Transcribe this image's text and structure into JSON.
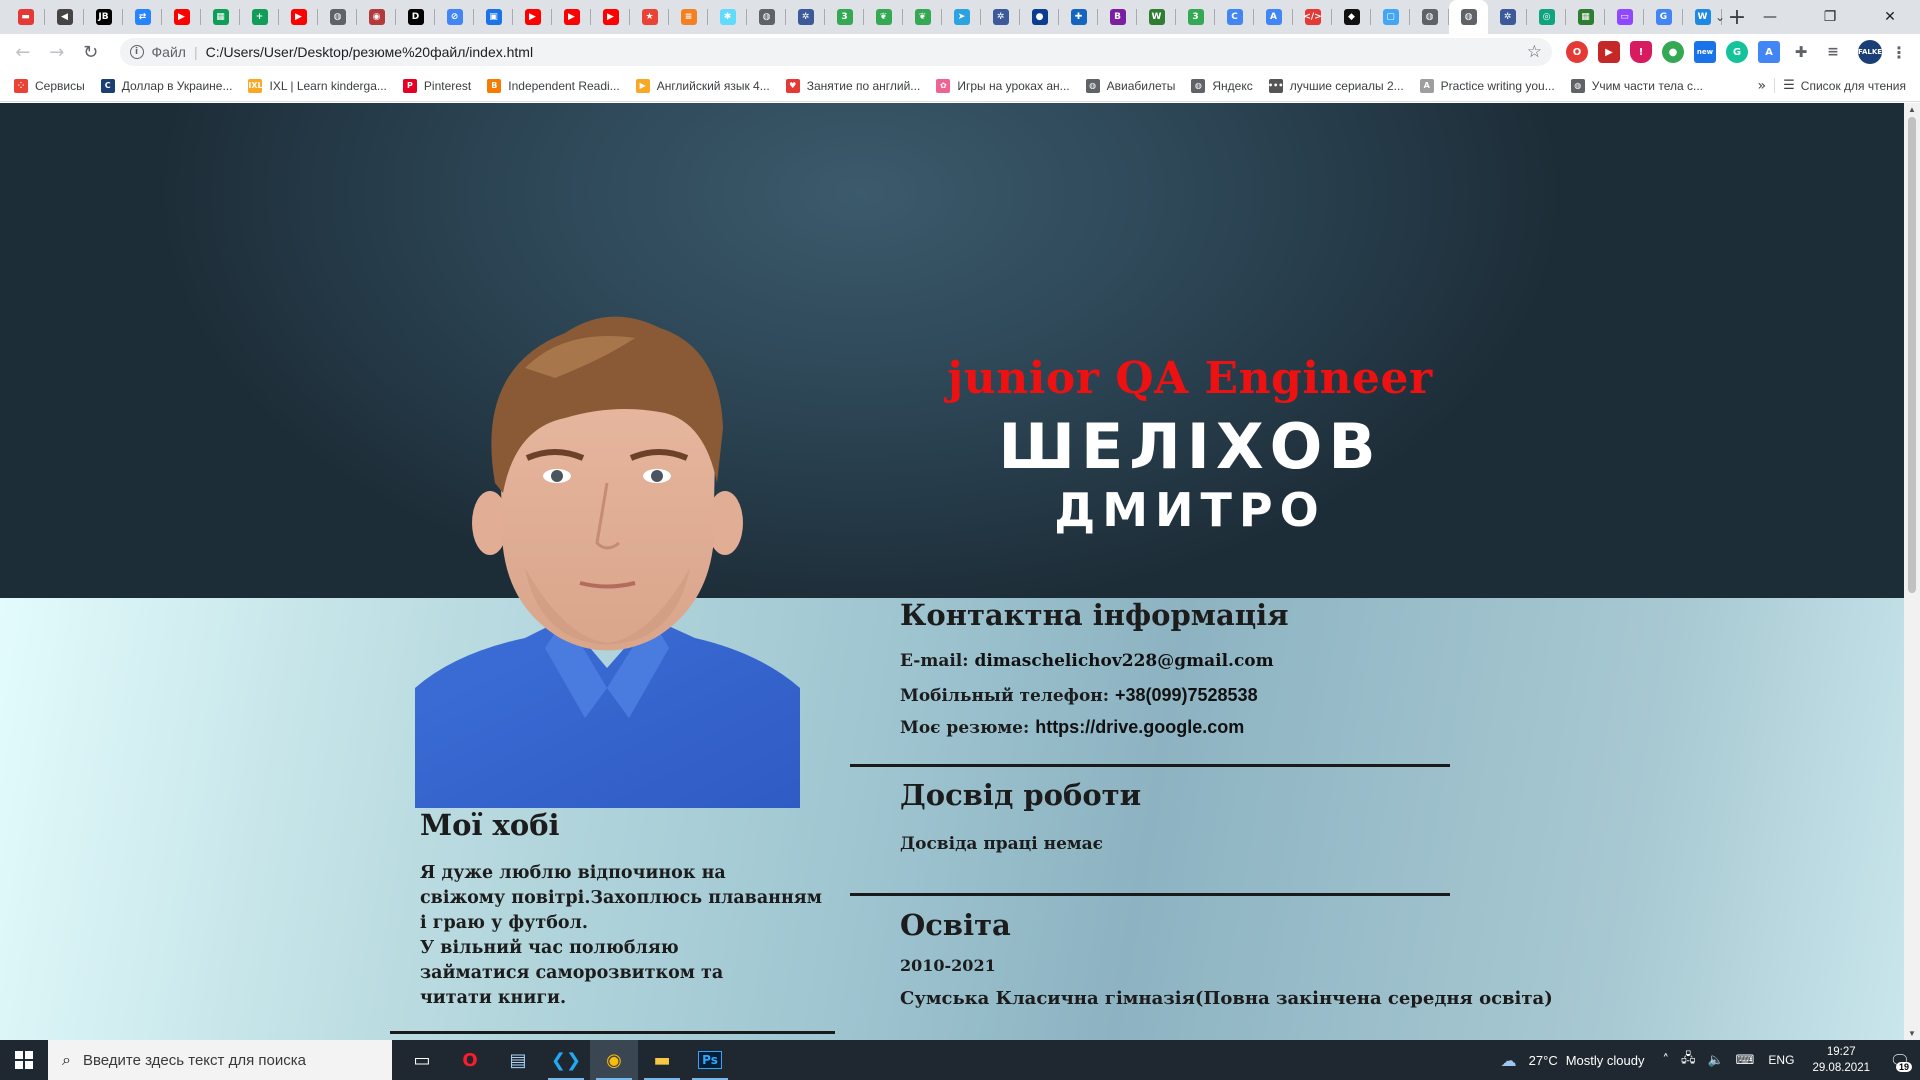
{
  "browser": {
    "tabs": [
      {
        "icon": "dou-icon",
        "color": "#e53935",
        "glyph": "▬"
      },
      {
        "icon": "audio-icon",
        "color": "#444444",
        "glyph": "◀"
      },
      {
        "icon": "jb-icon",
        "color": "#000000",
        "glyph": "JB"
      },
      {
        "icon": "jira-icon",
        "color": "#2684ff",
        "glyph": "⇄"
      },
      {
        "icon": "youtube-icon",
        "color": "#ff0000",
        "glyph": "▶"
      },
      {
        "icon": "sheets-icon",
        "color": "#0f9d58",
        "glyph": "▦"
      },
      {
        "icon": "sheets-plus-icon",
        "color": "#0f9d58",
        "glyph": "+"
      },
      {
        "icon": "youtube-icon",
        "color": "#ff0000",
        "glyph": "▶"
      },
      {
        "icon": "globe-icon",
        "color": "#5f6368",
        "glyph": "◍"
      },
      {
        "icon": "avatar-icon",
        "color": "#b23a3a",
        "glyph": "◉"
      },
      {
        "icon": "dou-text-icon",
        "color": "#000000",
        "glyph": "D"
      },
      {
        "icon": "compass-icon",
        "color": "#4285f4",
        "glyph": "⊘"
      },
      {
        "icon": "inbox-icon",
        "color": "#1a73e8",
        "glyph": "▣"
      },
      {
        "icon": "youtube-icon",
        "color": "#ff0000",
        "glyph": "▶"
      },
      {
        "icon": "youtube-icon",
        "color": "#ff0000",
        "glyph": "▶"
      },
      {
        "icon": "youtube-icon",
        "color": "#ff0000",
        "glyph": "▶"
      },
      {
        "icon": "star-icon",
        "color": "#ea4335",
        "glyph": "★"
      },
      {
        "icon": "stack-icon",
        "color": "#f48024",
        "glyph": "≡"
      },
      {
        "icon": "react-icon",
        "color": "#61dafb",
        "glyph": "✱"
      },
      {
        "icon": "globe-icon",
        "color": "#5f6368",
        "glyph": "◍"
      },
      {
        "icon": "gear-icon",
        "color": "#3c5a99",
        "glyph": "✲"
      },
      {
        "icon": "three-icon",
        "color": "#34a853",
        "glyph": "3"
      },
      {
        "icon": "leaf-icon",
        "color": "#34a853",
        "glyph": "❦"
      },
      {
        "icon": "leaf-icon",
        "color": "#34a853",
        "glyph": "❦"
      },
      {
        "icon": "telegram-icon",
        "color": "#2aa3e0",
        "glyph": "➤"
      },
      {
        "icon": "gear-icon",
        "color": "#3c5a99",
        "glyph": "✲"
      },
      {
        "icon": "circle-icon",
        "color": "#0b3d91",
        "glyph": "●"
      },
      {
        "icon": "puzzle-icon",
        "color": "#1565c0",
        "glyph": "✚"
      },
      {
        "icon": "bold-icon",
        "color": "#7b1fa2",
        "glyph": "B"
      },
      {
        "icon": "w-icon",
        "color": "#2e7d32",
        "glyph": "W"
      },
      {
        "icon": "three-icon",
        "color": "#34a853",
        "glyph": "3"
      },
      {
        "icon": "c-icon",
        "color": "#4285f4",
        "glyph": "C"
      },
      {
        "icon": "translate-icon",
        "color": "#4285f4",
        "glyph": "A"
      },
      {
        "icon": "code-icon",
        "color": "#e53935",
        "glyph": "</>"
      },
      {
        "icon": "diamond-icon",
        "color": "#111111",
        "glyph": "◆"
      },
      {
        "icon": "screenshot-icon",
        "color": "#42a5f5",
        "glyph": "▢"
      },
      {
        "icon": "globe-icon",
        "color": "#5f6368",
        "glyph": "◍"
      },
      {
        "icon": "globe-icon",
        "color": "#5f6368",
        "glyph": "◍"
      },
      {
        "icon": "gear-icon",
        "color": "#3c5a99",
        "glyph": "✲"
      },
      {
        "icon": "chatgpt-icon",
        "color": "#10a37f",
        "glyph": "◎"
      },
      {
        "icon": "grid-icon",
        "color": "#2e7d32",
        "glyph": "▦"
      },
      {
        "icon": "twitch-icon",
        "color": "#9146ff",
        "glyph": "▭"
      },
      {
        "icon": "google-icon",
        "color": "#4285f4",
        "glyph": "G"
      },
      {
        "icon": "w-icon",
        "color": "#1e88e5",
        "glyph": "W"
      }
    ],
    "active_tab_index": 37,
    "address": {
      "scheme_label": "Файл",
      "url": "C:/Users/User/Desktop/резюме%20файл/index.html"
    },
    "bookmarks": [
      {
        "label": "Сервисы",
        "icon": "apps-icon",
        "color": "#ea4335",
        "glyph": "⁘"
      },
      {
        "label": "Доллар в Украине...",
        "icon": "minfin-icon",
        "color": "#1a3e75",
        "glyph": "C"
      },
      {
        "label": "IXL | Learn kinderga...",
        "icon": "ixl-icon",
        "color": "#f9a825",
        "glyph": "IXL"
      },
      {
        "label": "Pinterest",
        "icon": "pinterest-icon",
        "color": "#e60023",
        "glyph": "P"
      },
      {
        "label": "Independent Readi...",
        "icon": "blogger-icon",
        "color": "#f57c00",
        "glyph": "B"
      },
      {
        "label": "Английский язык 4...",
        "icon": "play-icon",
        "color": "#f9a825",
        "glyph": "▶"
      },
      {
        "label": "Занятие по англий...",
        "icon": "heart-icon",
        "color": "#e53935",
        "glyph": "♥"
      },
      {
        "label": "Игры на уроках ан...",
        "icon": "flower-icon",
        "color": "#f06292",
        "glyph": "✿"
      },
      {
        "label": "Авиабилеты",
        "icon": "globe-icon",
        "color": "#5f6368",
        "glyph": "◍"
      },
      {
        "label": "Яндекс",
        "icon": "globe-icon",
        "color": "#5f6368",
        "glyph": "◍"
      },
      {
        "label": "лучшие сериалы 2...",
        "icon": "dots-icon",
        "color": "#555555",
        "glyph": "•••"
      },
      {
        "label": "Practice writing you...",
        "icon": "writing-icon",
        "color": "#9e9e9e",
        "glyph": "A"
      },
      {
        "label": "Учим части тела с...",
        "icon": "globe-icon",
        "color": "#5f6368",
        "glyph": "◍"
      }
    ],
    "reading_list_label": "Список для чтения"
  },
  "resume": {
    "role": "junior QA Engineer",
    "surname": "ШЕЛІХОВ",
    "first_name": "ДМИТРО",
    "contact": {
      "title": "Контактна інформація",
      "email_label": "E-mail:",
      "email": "dimaschelichov228@gmail.com",
      "phone_label": "Мобільный телефон:",
      "phone": "+38(099)7528538",
      "resume_label": "Моє резюме:",
      "resume_link": "https://drive.google.com"
    },
    "experience": {
      "title": "Досвід роботи",
      "text": "Досвіда праці немає"
    },
    "education": {
      "title": "Освіта",
      "years": "2010-2021",
      "school": "Сумська Класична гімназія(Повна закінчена середня освіта)"
    },
    "hobbies": {
      "title": "Мої хобі",
      "lines": [
        "Я дуже люблю відпочинок на",
        "свіжому повітрі.Захоплюсь плаванням",
        "і граю у футбол.",
        "У вільний час полюбляю",
        "займатися саморозвитком та",
        "читати книги."
      ]
    }
  },
  "taskbar": {
    "search_placeholder": "Введите здесь текст для поиска",
    "apps": [
      {
        "icon": "task-view-icon",
        "running": false
      },
      {
        "icon": "opera-icon",
        "running": false
      },
      {
        "icon": "notepad-icon",
        "running": false
      },
      {
        "icon": "vscode-icon",
        "running": true
      },
      {
        "icon": "chrome-icon",
        "running": true,
        "active": true
      },
      {
        "icon": "file-explorer-icon",
        "running": true
      },
      {
        "icon": "photoshop-icon",
        "running": true
      }
    ],
    "weather": {
      "temp": "27°C",
      "condition": "Mostly cloudy"
    },
    "language": "ENG",
    "time": "19:27",
    "date": "29.08.2021",
    "notification_count": "19"
  }
}
